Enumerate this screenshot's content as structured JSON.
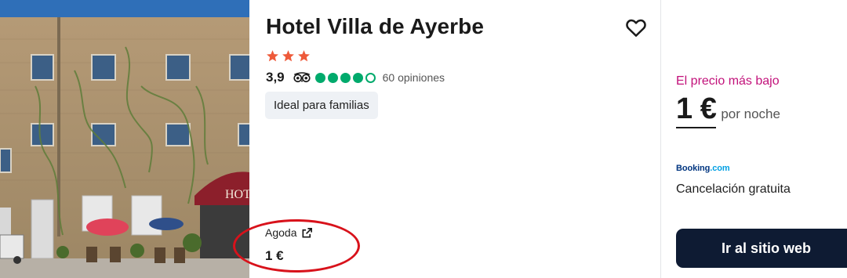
{
  "hotel": {
    "name": "Hotel Villa de Ayerbe",
    "star_count": 3,
    "star_color": "#ee5a3a",
    "rating": "3,9",
    "bubble_rating": 4,
    "bubble_max": 5,
    "reviews_label": "60 opiniones",
    "tag": "Ideal para familias",
    "photo_sign_text": "HOT"
  },
  "provider": {
    "name": "Agoda",
    "price": "1 €"
  },
  "deal": {
    "lowest_label": "El precio más bajo",
    "price": "1 €",
    "per_night": "por noche",
    "booking_brand": "Booking",
    "booking_tld": ".com",
    "cancellation": "Cancelación gratuita",
    "cta_label": "Ir al sitio web"
  },
  "icons": {
    "favorite": "heart-icon",
    "tripadvisor": "tripadvisor-owl-icon",
    "external_link": "external-link-icon",
    "star": "star-icon"
  },
  "colors": {
    "accent_pink": "#c2117a",
    "cta_bg": "#0e1b33",
    "bubble_green": "#00aa6c",
    "annotation_red": "#d8121b"
  }
}
